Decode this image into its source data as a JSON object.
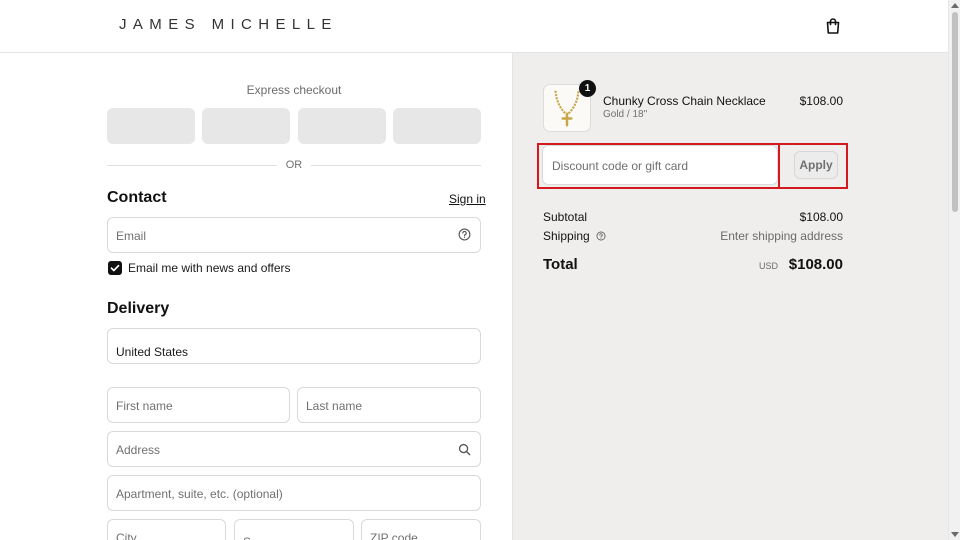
{
  "brand": {
    "logo_text": "JAMES MICHELLE"
  },
  "header": {
    "cart_icon": "shopping-bag-icon"
  },
  "express": {
    "title": "Express checkout",
    "divider": "OR"
  },
  "contact": {
    "title": "Contact",
    "sign_in": "Sign in",
    "email_placeholder": "Email",
    "newsletter_label": "Email me with news and offers",
    "newsletter_checked": true
  },
  "delivery": {
    "title": "Delivery",
    "country_value": "United States",
    "first_name_placeholder": "First name",
    "last_name_placeholder": "Last name",
    "address_placeholder": "Address",
    "apartment_placeholder": "Apartment, suite, etc. (optional)",
    "city_placeholder": "City",
    "state_placeholder": "S",
    "zip_placeholder": "ZIP code"
  },
  "order": {
    "item": {
      "name": "Chunky Cross Chain Necklace",
      "variant": "Gold / 18\"",
      "price": "$108.00",
      "quantity": "1"
    },
    "discount": {
      "placeholder": "Discount code or gift card",
      "apply_label": "Apply"
    },
    "subtotal_label": "Subtotal",
    "subtotal_value": "$108.00",
    "shipping_label": "Shipping",
    "shipping_value": "Enter shipping address",
    "total_label": "Total",
    "total_currency": "USD",
    "total_value": "$108.00"
  },
  "colors": {
    "highlight": "#d4181f",
    "sidebar_bg": "#f0eeed",
    "express_btn": "#e7e7e7"
  }
}
